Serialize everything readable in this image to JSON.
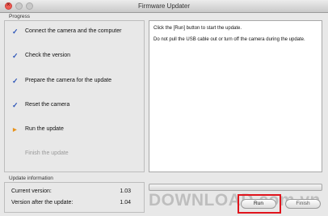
{
  "window": {
    "title": "Firmware Updater",
    "controls": [
      "close",
      "minimize",
      "zoom"
    ]
  },
  "progress_section": {
    "label": "Progress",
    "steps": [
      {
        "label": "Connect the camera and the computer",
        "status": "done",
        "icon": "checkmark-icon"
      },
      {
        "label": "Check the version",
        "status": "done",
        "icon": "checkmark-icon"
      },
      {
        "label": "Prepare the camera for the update",
        "status": "done",
        "icon": "checkmark-icon"
      },
      {
        "label": "Reset the camera",
        "status": "done",
        "icon": "checkmark-icon"
      },
      {
        "label": "Run the update",
        "status": "current",
        "icon": "arrow-right-icon"
      },
      {
        "label": "Finish the update",
        "status": "pending",
        "icon": ""
      }
    ]
  },
  "message": {
    "lines": [
      "Click the [Run] button to start the update.",
      "Do not pull the USB cable out or turn off the camera during the update."
    ]
  },
  "update_progress": 0,
  "update_info": {
    "label": "Update information",
    "current_version_label": "Current version:",
    "current_version": "1.03",
    "after_version_label": "Version after the update:",
    "after_version": "1.04"
  },
  "buttons": {
    "run": "Run",
    "finish": "Finish"
  },
  "watermark": "DOWNLOAD.com.vn",
  "colors": {
    "check": "#2d55b8",
    "current_arrow": "#e8921a",
    "highlight": "#e0141c"
  }
}
